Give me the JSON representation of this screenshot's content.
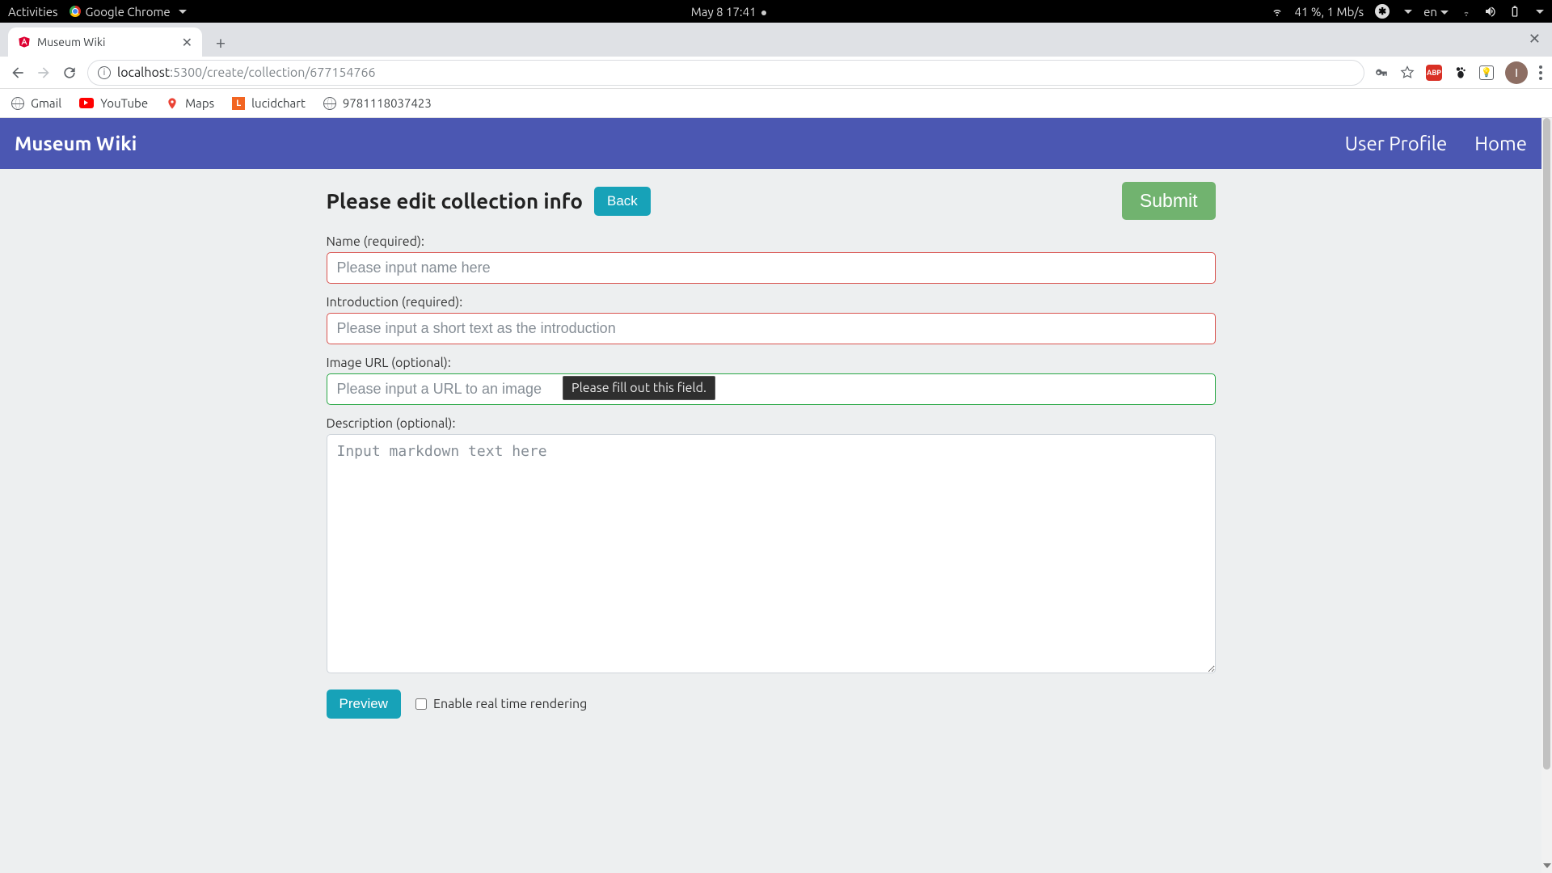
{
  "gnome": {
    "activities": "Activities",
    "app_name": "Google Chrome",
    "clock": "May 8  17:41",
    "battery": "41 %, 1 Mb/s",
    "lang": "en"
  },
  "browser": {
    "tab_title": "Museum Wiki",
    "url_host": "localhost",
    "url_path": ":5300/create/collection/677154766",
    "avatar_letter": "I"
  },
  "bookmarks": {
    "gmail": "Gmail",
    "youtube": "YouTube",
    "maps": "Maps",
    "lucidchart": "lucidchart",
    "isbn": "9781118037423"
  },
  "nav": {
    "brand": "Museum Wiki",
    "profile": "User Profile",
    "home": "Home"
  },
  "page": {
    "heading": "Please edit collection info",
    "back": "Back",
    "submit": "Submit",
    "tooltip": "Please fill out this field.",
    "preview": "Preview",
    "realtime_label": "Enable real time rendering"
  },
  "fields": {
    "name_label": "Name (required):",
    "name_placeholder": "Please input name here",
    "intro_label": "Introduction (required):",
    "intro_placeholder": "Please input a short text as the introduction",
    "image_label": "Image URL (optional):",
    "image_placeholder": "Please input a URL to an image",
    "desc_label": "Description (optional):",
    "desc_placeholder": "Input markdown text here"
  }
}
